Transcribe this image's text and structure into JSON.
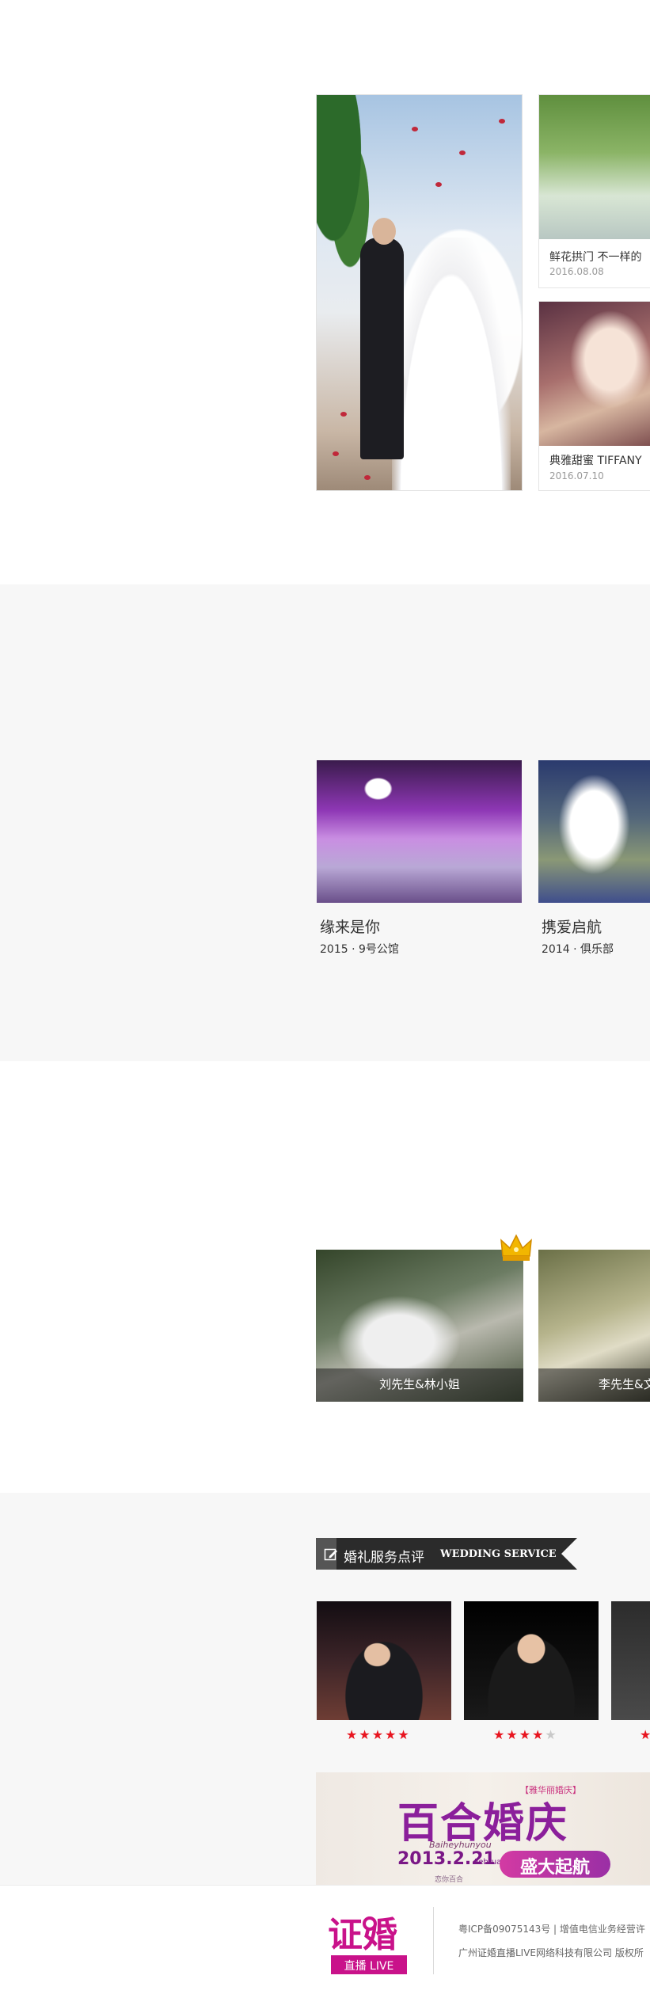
{
  "featured": {
    "card_a": {
      "title": "鲜花拱门 不一样的",
      "date": "2016.08.08"
    },
    "card_b": {
      "title": "典雅甜蜜 TIFFANY",
      "date": "2016.07.10"
    }
  },
  "venues": [
    {
      "name": "缘来是你",
      "meta": "2015 · 9号公馆"
    },
    {
      "name": "携爱启航",
      "meta": "2014 · 俱乐部"
    }
  ],
  "couples": [
    {
      "caption": "刘先生&林小姐"
    },
    {
      "caption": "李先生&文"
    }
  ],
  "reviews": {
    "section_title": "婚礼服务点评",
    "section_title_en": "WEDDING SERVICE",
    "hosts": [
      {
        "rating": 5,
        "stars_on": "★★★★★",
        "stars_off": ""
      },
      {
        "rating": 4,
        "stars_on": "★★★★",
        "stars_off": "★"
      },
      {
        "rating": 1,
        "stars_on": "★",
        "stars_off": ""
      }
    ]
  },
  "banner": {
    "tag": "【雅华丽婚庆】",
    "headline": "百合婚庆",
    "script": "Baiheyhunyou",
    "date": "2013.2.21",
    "month": "February",
    "cta": "盛大起航",
    "sub": "恋你百合"
  },
  "footer": {
    "logo_text": "证婚",
    "logo_sub": "直播 LIVE",
    "line1": "粤ICP备09075143号 | 增值电信业务经营许",
    "line2": "广州证婚直播LIVE网络科技有限公司 版权所"
  },
  "colors": {
    "accent_purple": "#8b1f9b",
    "brand_magenta": "#c9128a",
    "star_red": "#e8141f",
    "section_gray": "#f7f7f7"
  }
}
